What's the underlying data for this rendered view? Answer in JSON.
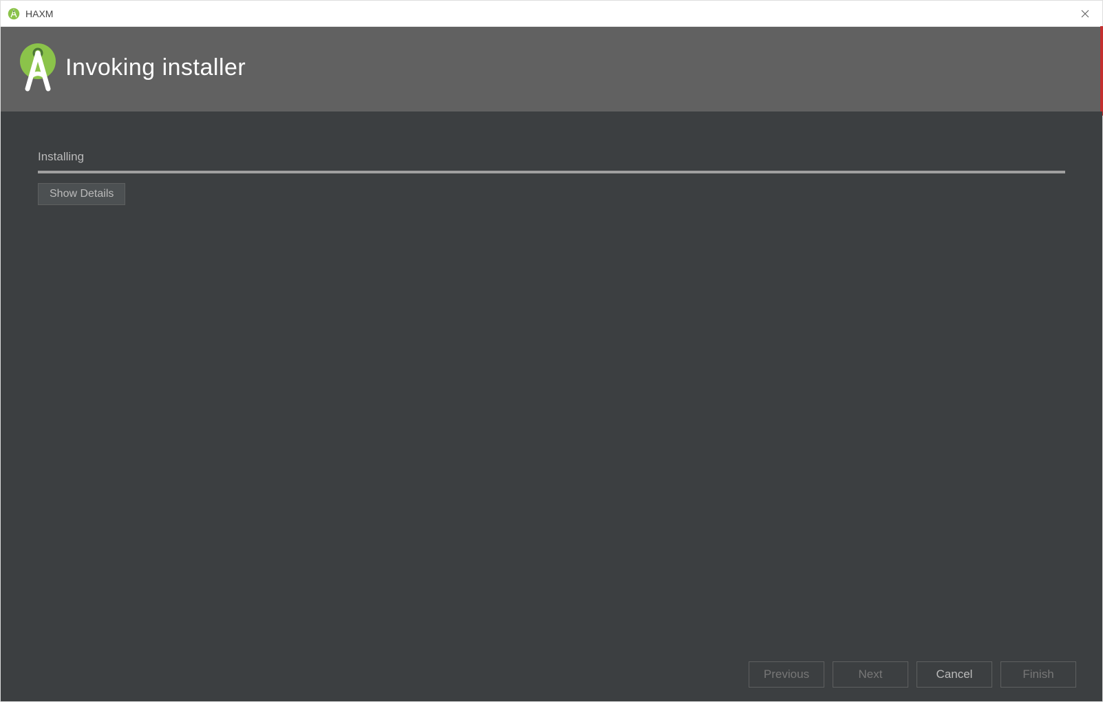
{
  "window": {
    "title": "HAXM"
  },
  "header": {
    "title": "Invoking installer"
  },
  "content": {
    "status": "Installing",
    "show_details_label": "Show Details"
  },
  "footer": {
    "previous_label": "Previous",
    "next_label": "Next",
    "cancel_label": "Cancel",
    "finish_label": "Finish"
  },
  "colors": {
    "accent_green": "#8bc34a",
    "header_bg": "#616161",
    "content_bg": "#3c3f41"
  }
}
